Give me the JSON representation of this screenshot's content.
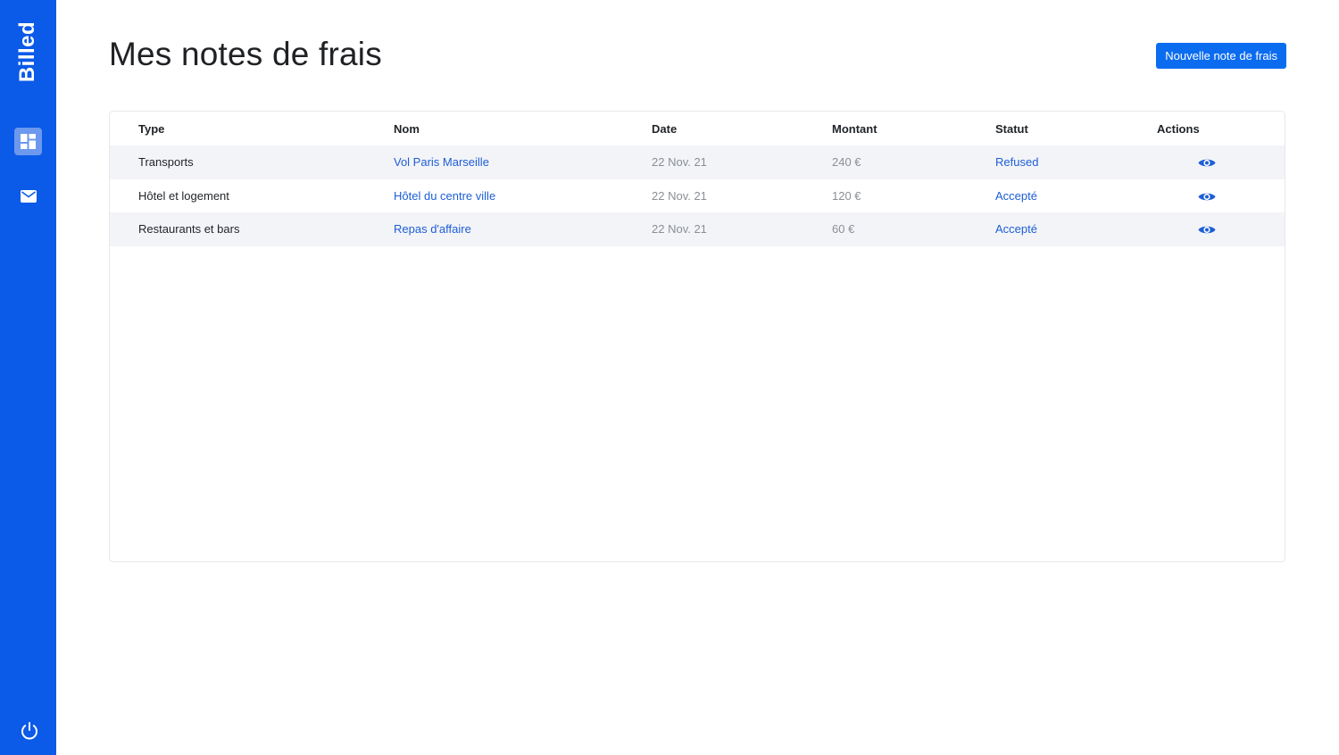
{
  "app": {
    "brand": "Billed"
  },
  "sidebar": {
    "items": [
      {
        "icon": "dashboard-icon",
        "active": true
      },
      {
        "icon": "mail-icon",
        "active": false
      }
    ],
    "footer_icon": "power-icon"
  },
  "header": {
    "title": "Mes notes de frais",
    "new_button_label": "Nouvelle note de frais"
  },
  "table": {
    "columns": [
      "Type",
      "Nom",
      "Date",
      "Montant",
      "Statut",
      "Actions"
    ],
    "rows": [
      {
        "type": "Transports",
        "nom": "Vol Paris Marseille",
        "date": "22 Nov. 21",
        "montant": "240 €",
        "statut": "Refused",
        "action_icon": "eye-icon"
      },
      {
        "type": "Hôtel et logement",
        "nom": "Hôtel du centre ville",
        "date": "22 Nov. 21",
        "montant": "120 €",
        "statut": "Accepté",
        "action_icon": "eye-icon"
      },
      {
        "type": "Restaurants et bars",
        "nom": "Repas d'affaire",
        "date": "22 Nov. 21",
        "montant": "60 €",
        "statut": "Accepté",
        "action_icon": "eye-icon"
      }
    ]
  },
  "colors": {
    "sidebar": "#0b5ae8",
    "active_nav": "#6c98ee",
    "primary_button": "#0b6cf0",
    "link": "#1d5ed6",
    "muted": "#8a8f95",
    "row_stripe": "#f3f4f8"
  }
}
